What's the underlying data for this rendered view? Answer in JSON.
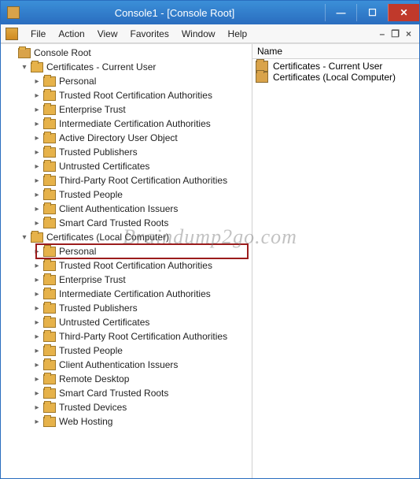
{
  "window": {
    "title": "Console1 - [Console Root]"
  },
  "menu": {
    "items": [
      "File",
      "Action",
      "View",
      "Favorites",
      "Window",
      "Help"
    ]
  },
  "right_panel": {
    "column_header": "Name",
    "items": [
      "Certificates - Current User",
      "Certificates (Local Computer)"
    ]
  },
  "tree": [
    {
      "depth": 0,
      "exp": "",
      "icon": "root",
      "label": "Console Root"
    },
    {
      "depth": 1,
      "exp": "▾",
      "icon": "cert",
      "label": "Certificates - Current User"
    },
    {
      "depth": 2,
      "exp": "▸",
      "icon": "folder",
      "label": "Personal"
    },
    {
      "depth": 2,
      "exp": "▸",
      "icon": "folder",
      "label": "Trusted Root Certification Authorities"
    },
    {
      "depth": 2,
      "exp": "▸",
      "icon": "folder",
      "label": "Enterprise Trust"
    },
    {
      "depth": 2,
      "exp": "▸",
      "icon": "folder",
      "label": "Intermediate Certification Authorities"
    },
    {
      "depth": 2,
      "exp": "▸",
      "icon": "folder",
      "label": "Active Directory User Object"
    },
    {
      "depth": 2,
      "exp": "▸",
      "icon": "folder",
      "label": "Trusted Publishers"
    },
    {
      "depth": 2,
      "exp": "▸",
      "icon": "folder",
      "label": "Untrusted Certificates"
    },
    {
      "depth": 2,
      "exp": "▸",
      "icon": "folder",
      "label": "Third-Party Root Certification Authorities"
    },
    {
      "depth": 2,
      "exp": "▸",
      "icon": "folder",
      "label": "Trusted People"
    },
    {
      "depth": 2,
      "exp": "▸",
      "icon": "folder",
      "label": "Client Authentication Issuers"
    },
    {
      "depth": 2,
      "exp": "▸",
      "icon": "folder",
      "label": "Smart Card Trusted Roots"
    },
    {
      "depth": 1,
      "exp": "▾",
      "icon": "cert",
      "label": "Certificates (Local Computer)"
    },
    {
      "depth": 2,
      "exp": "▸",
      "icon": "folder",
      "label": "Personal",
      "highlight": true
    },
    {
      "depth": 2,
      "exp": "▸",
      "icon": "folder",
      "label": "Trusted Root Certification Authorities"
    },
    {
      "depth": 2,
      "exp": "▸",
      "icon": "folder",
      "label": "Enterprise Trust"
    },
    {
      "depth": 2,
      "exp": "▸",
      "icon": "folder",
      "label": "Intermediate Certification Authorities"
    },
    {
      "depth": 2,
      "exp": "▸",
      "icon": "folder",
      "label": "Trusted Publishers"
    },
    {
      "depth": 2,
      "exp": "▸",
      "icon": "folder",
      "label": "Untrusted Certificates"
    },
    {
      "depth": 2,
      "exp": "▸",
      "icon": "folder",
      "label": "Third-Party Root Certification Authorities"
    },
    {
      "depth": 2,
      "exp": "▸",
      "icon": "folder",
      "label": "Trusted People"
    },
    {
      "depth": 2,
      "exp": "▸",
      "icon": "folder",
      "label": "Client Authentication Issuers"
    },
    {
      "depth": 2,
      "exp": "▸",
      "icon": "folder",
      "label": "Remote Desktop"
    },
    {
      "depth": 2,
      "exp": "▸",
      "icon": "folder",
      "label": "Smart Card Trusted Roots"
    },
    {
      "depth": 2,
      "exp": "▸",
      "icon": "folder",
      "label": "Trusted Devices"
    },
    {
      "depth": 2,
      "exp": "▸",
      "icon": "folder",
      "label": "Web Hosting"
    }
  ],
  "watermark": "Braindump2go.com"
}
